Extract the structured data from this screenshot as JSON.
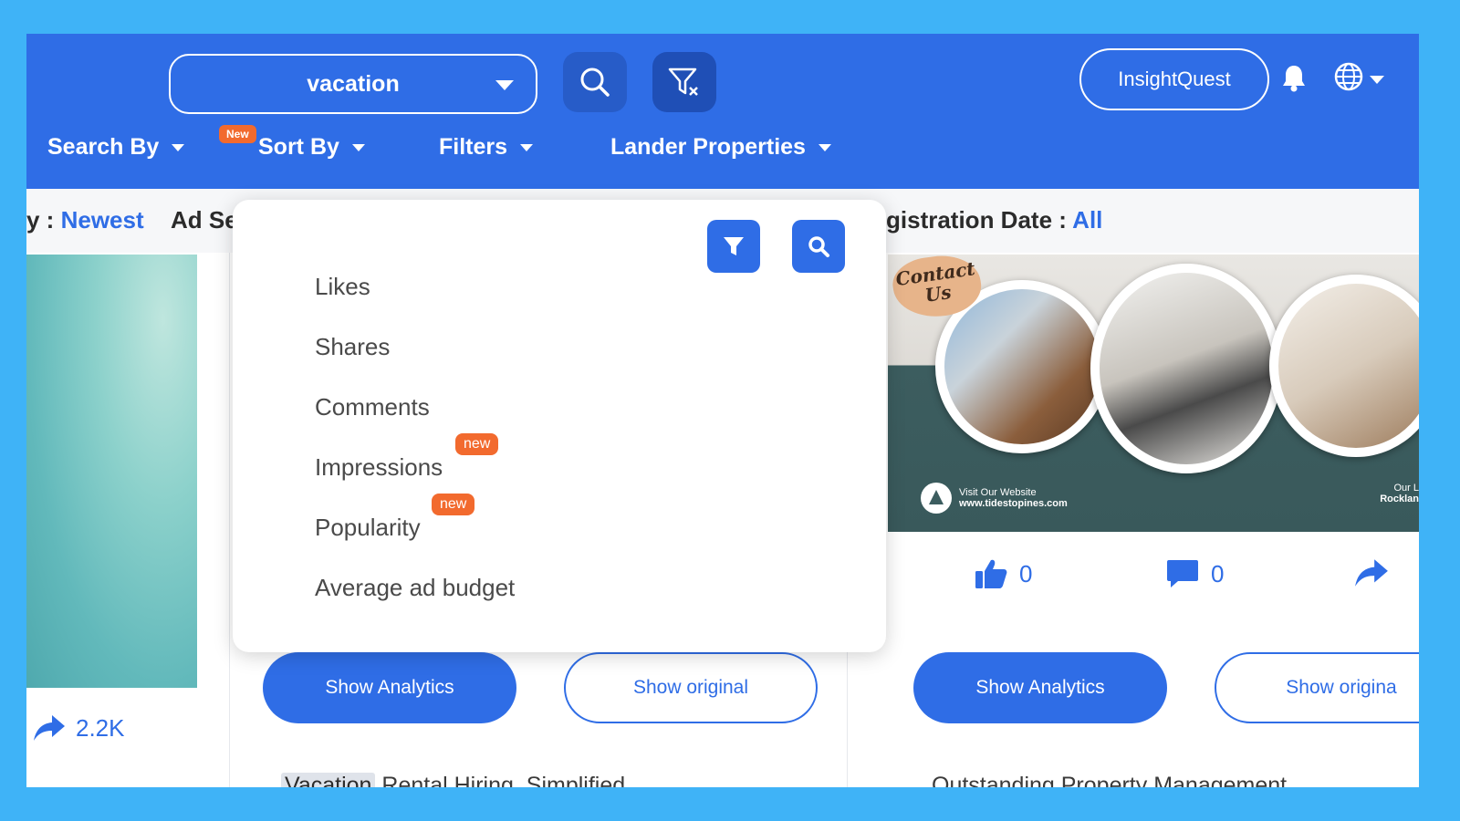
{
  "header": {
    "search_value": "vacation",
    "insight_label": "InsightQuest"
  },
  "nav": {
    "search_by": "Search By",
    "sort_by": "Sort By",
    "sort_by_badge": "New",
    "filters": "Filters",
    "lander_properties": "Lander Properties"
  },
  "strip": {
    "left_label": "y : ",
    "left_value": "Newest",
    "mid_label": "Ad Se",
    "right_label": "gistration Date : ",
    "right_value": "All"
  },
  "left_card": {
    "share_count": "2.2K"
  },
  "mid_card": {
    "analytics_label": "Show Analytics",
    "original_label": "Show original",
    "title_highlight": "Vacation",
    "title_rest": " Rental Hiring, Simplified"
  },
  "right_card": {
    "contact_text": "Contact Us",
    "visit_line1": "Visit Our Website",
    "visit_line2": "www.tidestopines.com",
    "rock_line1": "Our L",
    "rock_line2": "Rocklan",
    "likes": "0",
    "comments": "0",
    "analytics_label": "Show Analytics",
    "original_label": "Show origina",
    "title": "Outstanding Property Management"
  },
  "sort_dropdown": {
    "items": [
      {
        "label": "Likes",
        "badge": ""
      },
      {
        "label": "Shares",
        "badge": ""
      },
      {
        "label": "Comments",
        "badge": ""
      },
      {
        "label": "Impressions",
        "badge": "new"
      },
      {
        "label": "Popularity",
        "badge": "new"
      },
      {
        "label": "Average ad budget",
        "badge": ""
      }
    ]
  },
  "colors": {
    "primary": "#2f6de6",
    "badge": "#f26a2e",
    "background": "#3fb3f7"
  },
  "icons": [
    "search-icon",
    "filter-clear-icon",
    "bell-icon",
    "globe-icon",
    "filter-icon",
    "share-icon",
    "like-icon",
    "comment-icon"
  ]
}
